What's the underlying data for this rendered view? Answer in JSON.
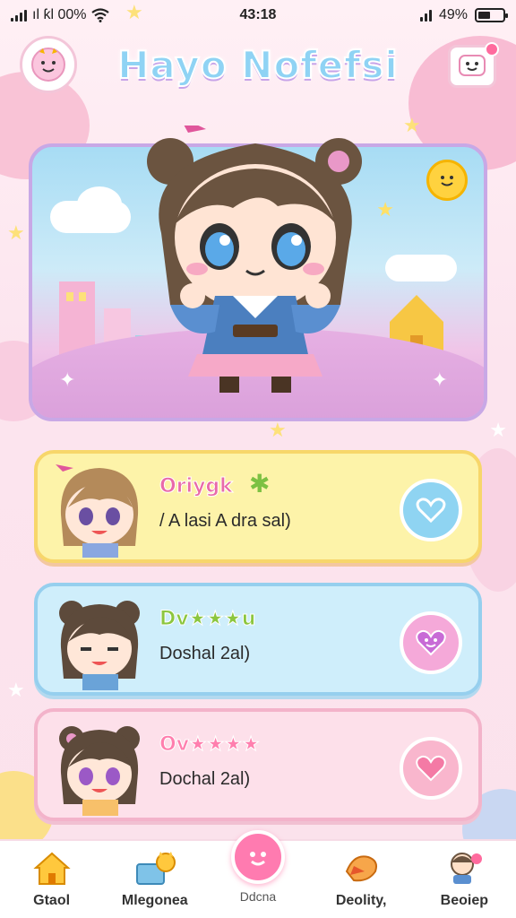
{
  "status": {
    "carrier": "ıl ƙl 00%",
    "time": "43:18",
    "battery_text": "49%",
    "battery_level": 0.49
  },
  "header": {
    "title": "Hayo Nofefsi"
  },
  "cards": [
    {
      "name": "Oriygk",
      "sub": "/ A lasi  A dra sal)",
      "name_color": "#e96aa9"
    },
    {
      "name": "Dv★★★u",
      "sub": "Doshal 2al)",
      "name_color": "#8cc63f"
    },
    {
      "name": "Ov★★★★",
      "sub": "Dochal 2al)",
      "name_color": "#ff7fae"
    }
  ],
  "nav": [
    {
      "label": "Gtaol",
      "icon": "home-icon"
    },
    {
      "label": "Mlegonea",
      "icon": "cat-box-icon"
    },
    {
      "label": "Ddcna",
      "icon": "face-bubble-icon"
    },
    {
      "label": "Deolity,",
      "icon": "bird-icon"
    },
    {
      "label": "Beoiep",
      "icon": "character-icon"
    }
  ],
  "colors": {
    "accent": "#ff7bb0",
    "card1": "#fdf3a9",
    "card2": "#cfeefb",
    "card3": "#fde0ea"
  }
}
